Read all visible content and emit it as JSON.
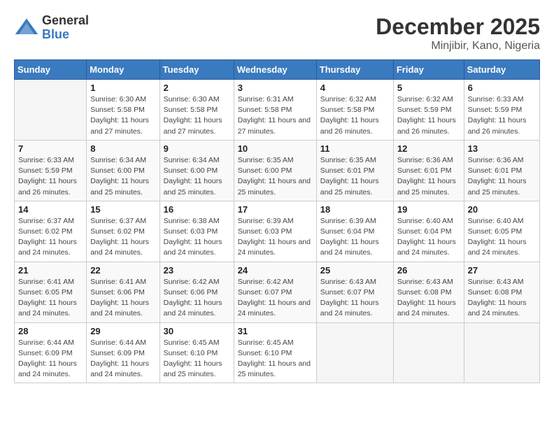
{
  "header": {
    "logo_general": "General",
    "logo_blue": "Blue",
    "month_year": "December 2025",
    "location": "Minjibir, Kano, Nigeria"
  },
  "days_of_week": [
    "Sunday",
    "Monday",
    "Tuesday",
    "Wednesday",
    "Thursday",
    "Friday",
    "Saturday"
  ],
  "weeks": [
    [
      {
        "day": "",
        "sunrise": "",
        "sunset": "",
        "daylight": ""
      },
      {
        "day": "1",
        "sunrise": "Sunrise: 6:30 AM",
        "sunset": "Sunset: 5:58 PM",
        "daylight": "Daylight: 11 hours and 27 minutes."
      },
      {
        "day": "2",
        "sunrise": "Sunrise: 6:30 AM",
        "sunset": "Sunset: 5:58 PM",
        "daylight": "Daylight: 11 hours and 27 minutes."
      },
      {
        "day": "3",
        "sunrise": "Sunrise: 6:31 AM",
        "sunset": "Sunset: 5:58 PM",
        "daylight": "Daylight: 11 hours and 27 minutes."
      },
      {
        "day": "4",
        "sunrise": "Sunrise: 6:32 AM",
        "sunset": "Sunset: 5:58 PM",
        "daylight": "Daylight: 11 hours and 26 minutes."
      },
      {
        "day": "5",
        "sunrise": "Sunrise: 6:32 AM",
        "sunset": "Sunset: 5:59 PM",
        "daylight": "Daylight: 11 hours and 26 minutes."
      },
      {
        "day": "6",
        "sunrise": "Sunrise: 6:33 AM",
        "sunset": "Sunset: 5:59 PM",
        "daylight": "Daylight: 11 hours and 26 minutes."
      }
    ],
    [
      {
        "day": "7",
        "sunrise": "Sunrise: 6:33 AM",
        "sunset": "Sunset: 5:59 PM",
        "daylight": "Daylight: 11 hours and 26 minutes."
      },
      {
        "day": "8",
        "sunrise": "Sunrise: 6:34 AM",
        "sunset": "Sunset: 6:00 PM",
        "daylight": "Daylight: 11 hours and 25 minutes."
      },
      {
        "day": "9",
        "sunrise": "Sunrise: 6:34 AM",
        "sunset": "Sunset: 6:00 PM",
        "daylight": "Daylight: 11 hours and 25 minutes."
      },
      {
        "day": "10",
        "sunrise": "Sunrise: 6:35 AM",
        "sunset": "Sunset: 6:00 PM",
        "daylight": "Daylight: 11 hours and 25 minutes."
      },
      {
        "day": "11",
        "sunrise": "Sunrise: 6:35 AM",
        "sunset": "Sunset: 6:01 PM",
        "daylight": "Daylight: 11 hours and 25 minutes."
      },
      {
        "day": "12",
        "sunrise": "Sunrise: 6:36 AM",
        "sunset": "Sunset: 6:01 PM",
        "daylight": "Daylight: 11 hours and 25 minutes."
      },
      {
        "day": "13",
        "sunrise": "Sunrise: 6:36 AM",
        "sunset": "Sunset: 6:01 PM",
        "daylight": "Daylight: 11 hours and 25 minutes."
      }
    ],
    [
      {
        "day": "14",
        "sunrise": "Sunrise: 6:37 AM",
        "sunset": "Sunset: 6:02 PM",
        "daylight": "Daylight: 11 hours and 24 minutes."
      },
      {
        "day": "15",
        "sunrise": "Sunrise: 6:37 AM",
        "sunset": "Sunset: 6:02 PM",
        "daylight": "Daylight: 11 hours and 24 minutes."
      },
      {
        "day": "16",
        "sunrise": "Sunrise: 6:38 AM",
        "sunset": "Sunset: 6:03 PM",
        "daylight": "Daylight: 11 hours and 24 minutes."
      },
      {
        "day": "17",
        "sunrise": "Sunrise: 6:39 AM",
        "sunset": "Sunset: 6:03 PM",
        "daylight": "Daylight: 11 hours and 24 minutes."
      },
      {
        "day": "18",
        "sunrise": "Sunrise: 6:39 AM",
        "sunset": "Sunset: 6:04 PM",
        "daylight": "Daylight: 11 hours and 24 minutes."
      },
      {
        "day": "19",
        "sunrise": "Sunrise: 6:40 AM",
        "sunset": "Sunset: 6:04 PM",
        "daylight": "Daylight: 11 hours and 24 minutes."
      },
      {
        "day": "20",
        "sunrise": "Sunrise: 6:40 AM",
        "sunset": "Sunset: 6:05 PM",
        "daylight": "Daylight: 11 hours and 24 minutes."
      }
    ],
    [
      {
        "day": "21",
        "sunrise": "Sunrise: 6:41 AM",
        "sunset": "Sunset: 6:05 PM",
        "daylight": "Daylight: 11 hours and 24 minutes."
      },
      {
        "day": "22",
        "sunrise": "Sunrise: 6:41 AM",
        "sunset": "Sunset: 6:06 PM",
        "daylight": "Daylight: 11 hours and 24 minutes."
      },
      {
        "day": "23",
        "sunrise": "Sunrise: 6:42 AM",
        "sunset": "Sunset: 6:06 PM",
        "daylight": "Daylight: 11 hours and 24 minutes."
      },
      {
        "day": "24",
        "sunrise": "Sunrise: 6:42 AM",
        "sunset": "Sunset: 6:07 PM",
        "daylight": "Daylight: 11 hours and 24 minutes."
      },
      {
        "day": "25",
        "sunrise": "Sunrise: 6:43 AM",
        "sunset": "Sunset: 6:07 PM",
        "daylight": "Daylight: 11 hours and 24 minutes."
      },
      {
        "day": "26",
        "sunrise": "Sunrise: 6:43 AM",
        "sunset": "Sunset: 6:08 PM",
        "daylight": "Daylight: 11 hours and 24 minutes."
      },
      {
        "day": "27",
        "sunrise": "Sunrise: 6:43 AM",
        "sunset": "Sunset: 6:08 PM",
        "daylight": "Daylight: 11 hours and 24 minutes."
      }
    ],
    [
      {
        "day": "28",
        "sunrise": "Sunrise: 6:44 AM",
        "sunset": "Sunset: 6:09 PM",
        "daylight": "Daylight: 11 hours and 24 minutes."
      },
      {
        "day": "29",
        "sunrise": "Sunrise: 6:44 AM",
        "sunset": "Sunset: 6:09 PM",
        "daylight": "Daylight: 11 hours and 24 minutes."
      },
      {
        "day": "30",
        "sunrise": "Sunrise: 6:45 AM",
        "sunset": "Sunset: 6:10 PM",
        "daylight": "Daylight: 11 hours and 25 minutes."
      },
      {
        "day": "31",
        "sunrise": "Sunrise: 6:45 AM",
        "sunset": "Sunset: 6:10 PM",
        "daylight": "Daylight: 11 hours and 25 minutes."
      },
      {
        "day": "",
        "sunrise": "",
        "sunset": "",
        "daylight": ""
      },
      {
        "day": "",
        "sunrise": "",
        "sunset": "",
        "daylight": ""
      },
      {
        "day": "",
        "sunrise": "",
        "sunset": "",
        "daylight": ""
      }
    ]
  ]
}
